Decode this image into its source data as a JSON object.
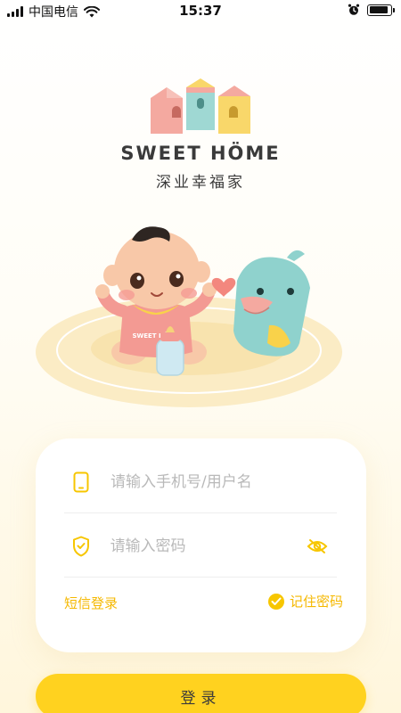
{
  "status_bar": {
    "carrier": "中国电信",
    "time": "15:37",
    "battery_level": 0.9
  },
  "logo": {
    "title": "SWEET HÖME",
    "subtitle": "深业幸福家"
  },
  "illustration": {
    "bib_text": "SWEET HÖME"
  },
  "login_form": {
    "phone_placeholder": "请输入手机号/用户名",
    "password_placeholder": "请输入密码",
    "sms_login_label": "短信登录",
    "remember_password_label": "记住密码",
    "remember_checked": true
  },
  "login_button_label": "登录",
  "colors": {
    "accent": "#ffd21f",
    "link": "#f5b800",
    "house_pink": "#f4a9a0",
    "house_teal": "#9fd8d3",
    "house_yellow": "#f9d76a"
  },
  "icons": {
    "phone": "phone-icon",
    "password": "shield-icon",
    "visibility": "eye-off-icon",
    "checkbox": "check-circle-icon"
  }
}
